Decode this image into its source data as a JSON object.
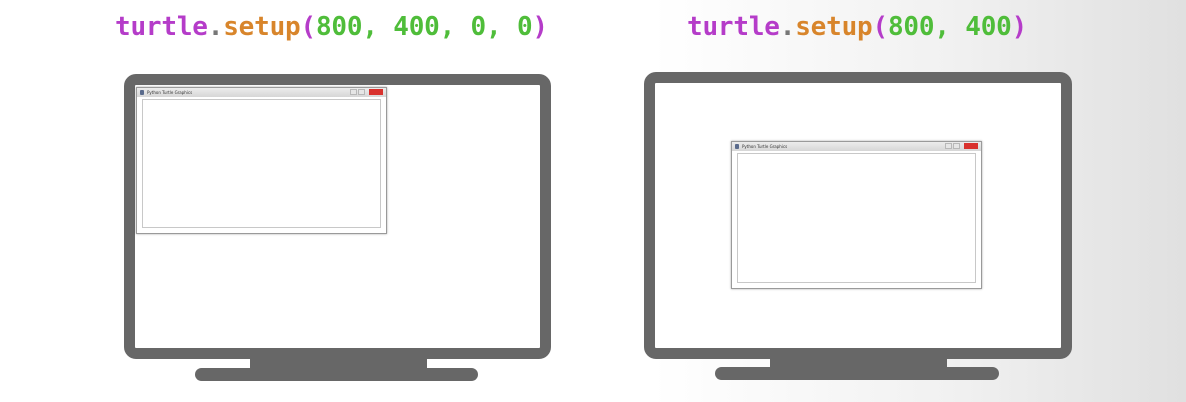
{
  "left": {
    "code": {
      "object": "turtle",
      "dot": ".",
      "method": "setup",
      "open": "(",
      "arg1": "800",
      "sep1": ", ",
      "arg2": "400",
      "sep2": ", ",
      "arg3": "0",
      "sep3": ", ",
      "arg4": "0",
      "close": ")"
    },
    "window_title": "Python Turtle Graphics"
  },
  "right": {
    "code": {
      "object": "turtle",
      "dot": ".",
      "method": "setup",
      "open": "(",
      "arg1": "800",
      "sep1": ", ",
      "arg2": "400",
      "close": ")"
    },
    "window_title": "Python Turtle Graphics"
  },
  "colors": {
    "object": "#b53cc9",
    "method": "#d8852b",
    "number": "#4fbd3a",
    "monitor": "#676767",
    "close_button": "#d9322e"
  }
}
